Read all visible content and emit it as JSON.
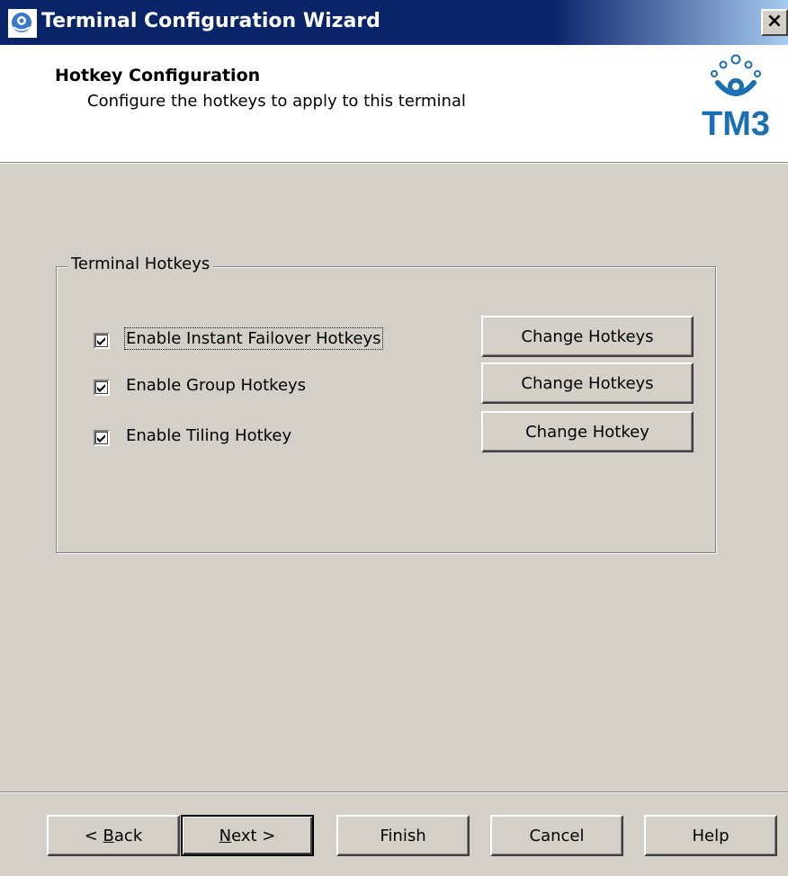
{
  "window": {
    "title": "Terminal Configuration Wizard",
    "close_glyph": "×"
  },
  "header": {
    "heading": "Hotkey Configuration",
    "subheading": "Configure the hotkeys to apply to this terminal",
    "logo_text": "TM3"
  },
  "group": {
    "legend": "Terminal Hotkeys",
    "options": [
      {
        "label": "Enable Instant Failover Hotkeys",
        "checked": true,
        "button": "Change Hotkeys"
      },
      {
        "label": "Enable Group Hotkeys",
        "checked": true,
        "button": "Change Hotkeys"
      },
      {
        "label": "Enable Tiling Hotkey",
        "checked": true,
        "button": "Change Hotkey"
      }
    ]
  },
  "footer": {
    "back_pre": "< ",
    "back_key": "B",
    "back_post": "ack",
    "next_key": "N",
    "next_post": "ext >",
    "finish": "Finish",
    "cancel": "Cancel",
    "help": "Help"
  },
  "colors": {
    "titlebar": "#0a246a",
    "face": "#d4d0c8",
    "logo_blue": "#1b6fb3"
  }
}
